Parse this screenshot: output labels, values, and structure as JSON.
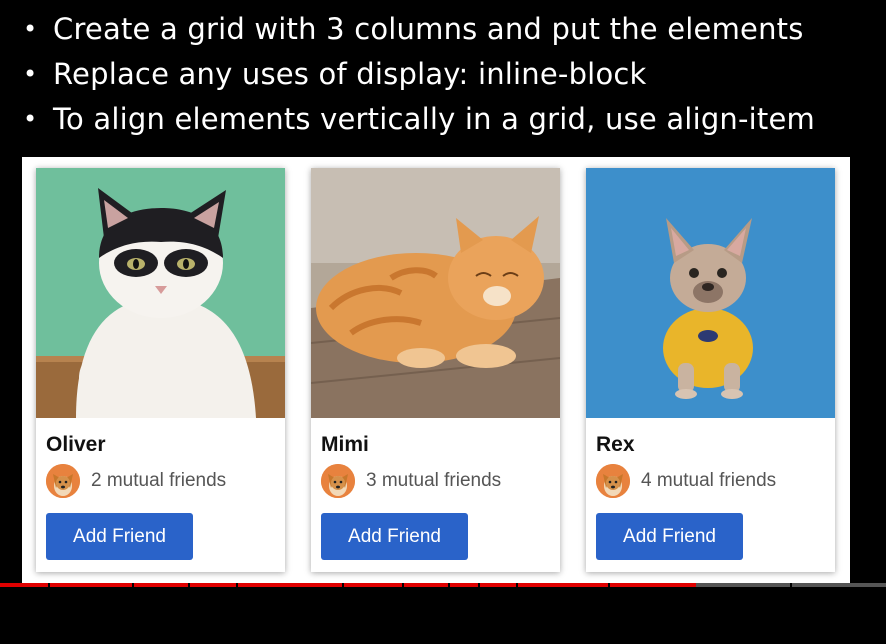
{
  "bullets": [
    {
      "symbol": "•",
      "text": "Create a grid with 3 columns and put the elements"
    },
    {
      "symbol": "•",
      "text": "Replace any uses of display: inline-block"
    },
    {
      "symbol": "•",
      "text": "To align elements vertically in a grid, use align-item"
    }
  ],
  "cards": [
    {
      "name": "Oliver",
      "mutual": "2 mutual friends",
      "button": "Add Friend",
      "photo": "cat-black-white",
      "background_color": "#6fbf9c"
    },
    {
      "name": "Mimi",
      "mutual": "3 mutual friends",
      "button": "Add Friend",
      "photo": "cat-orange",
      "background_color": "#9b8a78"
    },
    {
      "name": "Rex",
      "mutual": "4 mutual friends",
      "button": "Add Friend",
      "photo": "dog-french-bulldog",
      "background_color": "#3d8fcb"
    }
  ],
  "avatar_icon": "dog-avatar-icon",
  "colors": {
    "button": "#2a63c9",
    "progress_played": "#e00000",
    "progress_track": "#555555"
  },
  "video_progress": {
    "played_fraction": 0.785
  }
}
